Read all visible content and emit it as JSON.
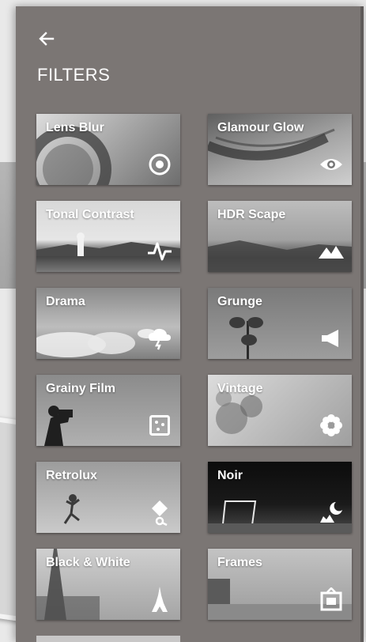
{
  "header": {
    "back_icon": "arrow-left-icon",
    "title": "FILTERS"
  },
  "filters": [
    {
      "label": "Lens Blur",
      "icon": "target-icon",
      "bg": "#b9b9b9"
    },
    {
      "label": "Glamour Glow",
      "icon": "eye-icon",
      "bg": "#8e8e8e"
    },
    {
      "label": "Tonal Contrast",
      "icon": "pulse-icon",
      "bg": "#c8c8c8"
    },
    {
      "label": "HDR Scape",
      "icon": "mountain-icon",
      "bg": "#b2b2b2"
    },
    {
      "label": "Drama",
      "icon": "storm-cloud-icon",
      "bg": "#9b9b9b"
    },
    {
      "label": "Grunge",
      "icon": "megaphone-icon",
      "bg": "#8a8a8a"
    },
    {
      "label": "Grainy Film",
      "icon": "film-grain-icon",
      "bg": "#a6a6a6"
    },
    {
      "label": "Vintage",
      "icon": "flower-icon",
      "bg": "#bdbdbd"
    },
    {
      "label": "Retrolux",
      "icon": "retrolux-icon",
      "bg": "#a9a9a9"
    },
    {
      "label": "Noir",
      "icon": "moon-night-icon",
      "bg": "#171717"
    },
    {
      "label": "Black & White",
      "icon": "eiffel-tower-icon",
      "bg": "#bcbcbc"
    },
    {
      "label": "Frames",
      "icon": "frame-icon",
      "bg": "#b6b6b6"
    }
  ]
}
